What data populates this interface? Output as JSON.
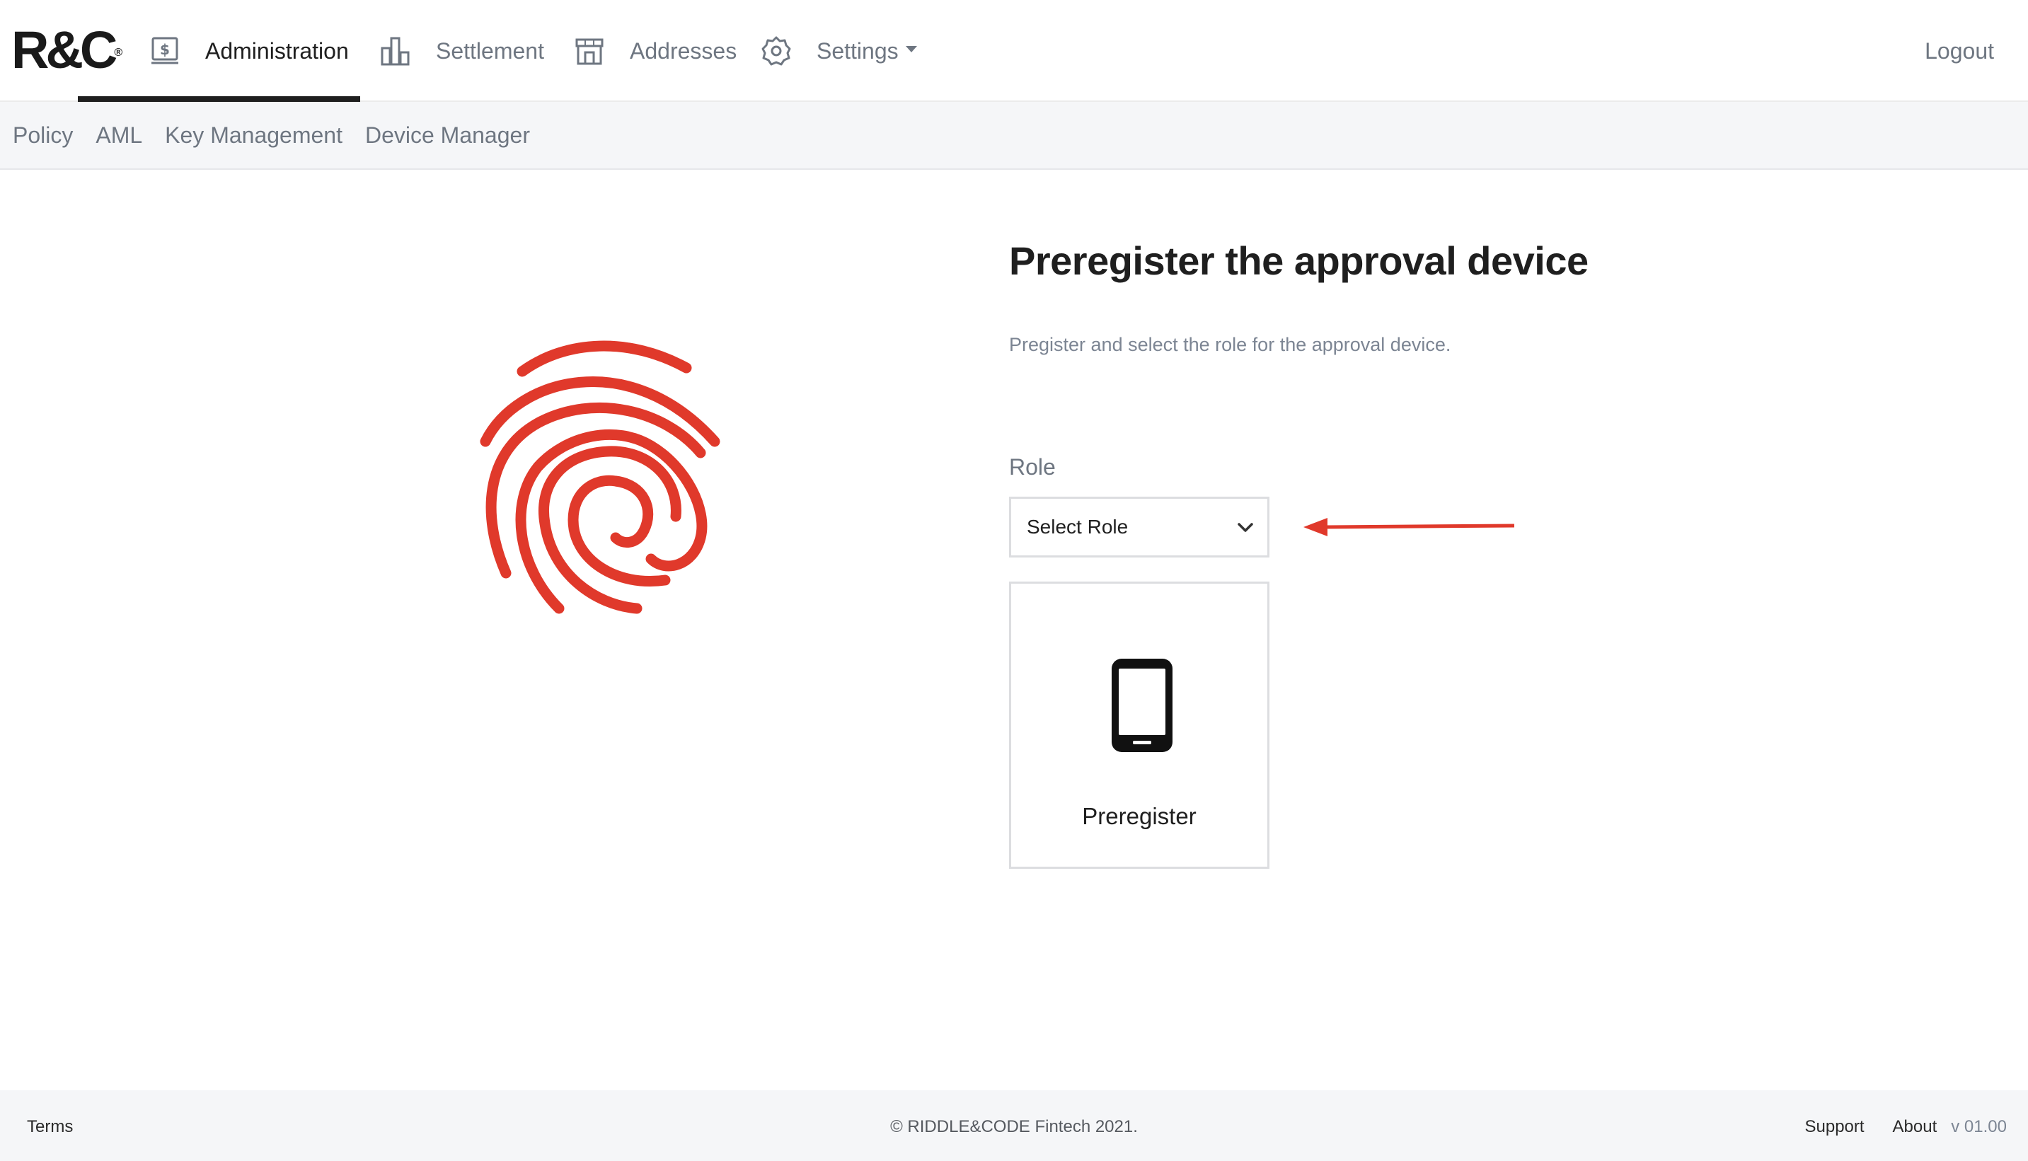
{
  "brand": {
    "logo_text": "R&C",
    "logo_mark": "®"
  },
  "nav": {
    "items": [
      {
        "label": "Administration",
        "icon": "dollar-document-icon",
        "active": true
      },
      {
        "label": "Settlement",
        "icon": "bar-chart-icon",
        "active": false
      },
      {
        "label": "Addresses",
        "icon": "storefront-icon",
        "active": false
      },
      {
        "label": "Settings",
        "icon": "gear-icon",
        "active": false,
        "dropdown": true
      }
    ],
    "logout_label": "Logout"
  },
  "subnav": {
    "items": [
      "Policy",
      "AML",
      "Key Management",
      "Device Manager"
    ]
  },
  "main": {
    "illustration_icon": "fingerprint-icon",
    "title": "Preregister the approval device",
    "subtitle": "Pregister and select the role for the approval device.",
    "role_label": "Role",
    "role_select_value": "Select Role",
    "card_icon": "smartphone-icon",
    "card_label": "Preregister"
  },
  "footer": {
    "terms": "Terms",
    "copyright": "© RIDDLE&CODE Fintech 2021.",
    "support": "Support",
    "about": "About",
    "version": "v 01.00"
  },
  "colors": {
    "accent_red": "#e0392b",
    "nav_active": "#1f1f1f",
    "muted_text": "#6e7681",
    "subbar_bg": "#f5f6f8"
  }
}
